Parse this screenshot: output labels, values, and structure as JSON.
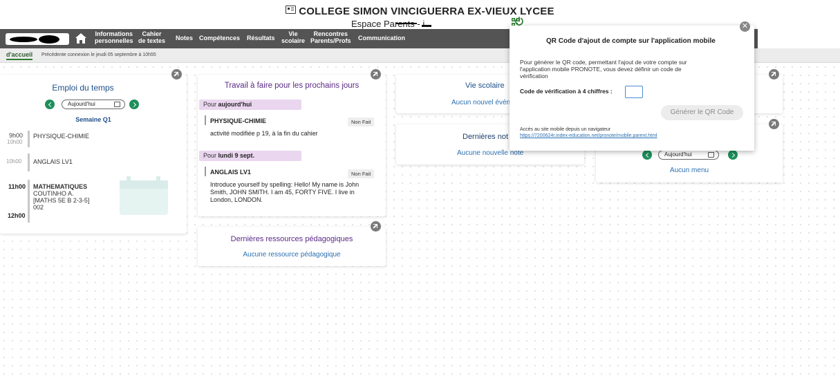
{
  "header": {
    "school_name": "COLLEGE SIMON VINCIGUERRA EX-VIEUX LYCEE",
    "espace": "Espace Parents - i...",
    "power_icon": "power-icon"
  },
  "nav": {
    "items": [
      {
        "line1": "Informations",
        "line2": "personnelles"
      },
      {
        "line1": "Cahier",
        "line2": "de textes"
      },
      {
        "line1": "Notes",
        "line2": ""
      },
      {
        "line1": "Compétences",
        "line2": ""
      },
      {
        "line1": "Résultats",
        "line2": ""
      },
      {
        "line1": "Vie",
        "line2": "scolaire"
      },
      {
        "line1": "Rencontres",
        "line2": "Parents/Profs"
      },
      {
        "line1": "Communication",
        "line2": ""
      }
    ]
  },
  "subbar": {
    "tab": "d'accueil",
    "last_connection": "Précédente connexion le jeudi 05 septembre à 10h55"
  },
  "emploi": {
    "title": "Emploi du temps",
    "date": "Aujourd'hui",
    "week": "Semaine Q1",
    "slots": [
      {
        "start": "9h00",
        "end": "10h00",
        "subject": "PHYSIQUE-CHIMIE"
      },
      {
        "start": "10h00",
        "subject": "ANGLAIS LV1"
      },
      {
        "start": "11h00",
        "end": "12h00",
        "subject": "MATHEMATIQUES",
        "teacher": "COUTINHO A.",
        "group": "[MATHS 5E B 2-3-5]",
        "room": "002"
      }
    ]
  },
  "travail": {
    "title": "Travail à faire pour les prochains jours",
    "groups": [
      {
        "prefix": "Pour ",
        "day": "aujourd'hui",
        "subject": "PHYSIQUE-CHIMIE",
        "status": "Non Fait",
        "text": "activité modifiée p 19, à la fin du cahier"
      },
      {
        "prefix": "Pour ",
        "day": "lundi 9 sept.",
        "subject": "ANGLAIS LV1",
        "status": "Non Fait",
        "text1": "Introduce yourself by spelling: Hello! My name is John",
        "text2": "Smith, JOHN SMITH. I am 45, FORTY FIVE. I live in",
        "text3": "London, LONDON."
      }
    ]
  },
  "ressources": {
    "title": "Dernières ressources pédagogiques",
    "empty": "Aucune ressource pédagogique"
  },
  "vie": {
    "title": "Vie scolaire",
    "empty": "Aucun nouvel évén"
  },
  "notes": {
    "title": "Dernières not",
    "empty": "Aucune nouvelle note"
  },
  "menu": {
    "date": "Aujourd'hui",
    "empty": "Aucun menu"
  },
  "modal": {
    "title": "QR Code d'ajout de compte sur l'application mobile",
    "desc1": "Pour générer le QR code, permettant l'ajout de votre compte sur",
    "desc2": "l'application mobile PRONOTE, vous devez définir un code de",
    "desc3": "vérification",
    "code_label": "Code de vérification à 4 chiffres :",
    "code_value": "",
    "generate": "Générer le QR Code",
    "footer": "Accès au site mobile depuis un navigateur",
    "link": "https://7200624r.index-education.net/pronote/mobile.parent.html"
  },
  "colors": {
    "nav_bg": "#545454",
    "accent_green": "#1e8f5a",
    "title_blue": "#1e4f8a",
    "title_purple": "#5b2a86",
    "pill_purple": "#ead6ef"
  }
}
